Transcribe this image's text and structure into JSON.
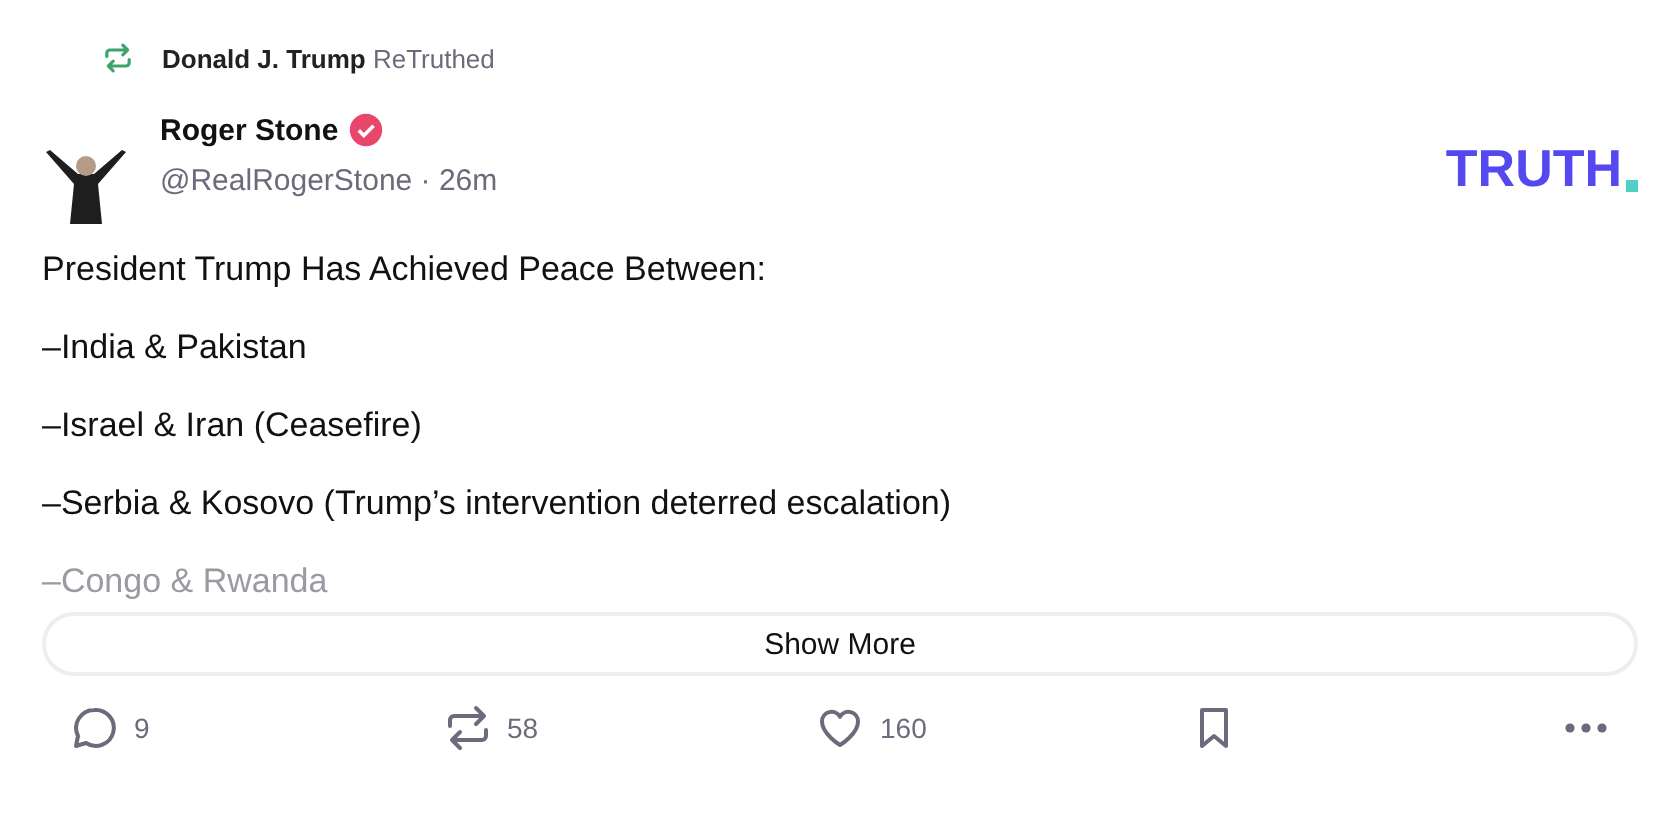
{
  "retruth": {
    "by": "Donald J. Trump",
    "action": "ReTruthed"
  },
  "post": {
    "author": "Roger Stone",
    "verified": true,
    "meta": "@RealRogerStone · 26m"
  },
  "logo": {
    "text": "TRUTH"
  },
  "body": [
    {
      "text": "President Trump Has Achieved Peace Between:",
      "faded": false
    },
    {
      "text": "–India & Pakistan",
      "faded": false
    },
    {
      "text": "–Israel & Iran (Ceasefire)",
      "faded": false
    },
    {
      "text": "–Serbia & Kosovo (Trump’s intervention deterred escalation)",
      "faded": false
    },
    {
      "text": "–Congo & Rwanda",
      "faded": true
    }
  ],
  "show_more": "Show More",
  "actions": [
    {
      "kind": "reply",
      "count": "9"
    },
    {
      "kind": "repost",
      "count": "58"
    },
    {
      "kind": "like",
      "count": "160"
    },
    {
      "kind": "bookmark"
    },
    {
      "kind": "more"
    }
  ]
}
